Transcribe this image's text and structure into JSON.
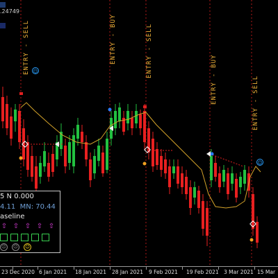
{
  "price_tag": ".24749",
  "signals": [
    {
      "label": "ENTRY - SELL"
    },
    {
      "label": "ENTRY - BUY"
    },
    {
      "label": "ENTRY - SELL"
    },
    {
      "label": "ENTRY - BUY"
    },
    {
      "label": "ENTRY - SELL"
    }
  ],
  "panel": {
    "line1": "5 N 0.000",
    "line2_a": "4.11",
    "line2_b": "MN: 70.44",
    "line3": "aseline",
    "arrows": [
      "⇧",
      "⇧",
      "⇧",
      "⇧",
      "⇧"
    ],
    "boxes": 5,
    "icons": [
      "☹",
      "☹",
      "☺"
    ]
  },
  "dates": [
    "23 Dec 2020",
    "6 Jan 2021",
    "18 Jan 2021",
    "28 Jan 2021",
    "9 Feb 2021",
    "19 Feb 2021",
    "3 Mar 2021",
    "15 Mar"
  ],
  "colors": {
    "background": "#000000",
    "bull": "#22c040",
    "bear": "#e82020",
    "baseline": "#d4a32a",
    "signal_text": "#f2b43a",
    "signal_line": "#c02020"
  }
}
